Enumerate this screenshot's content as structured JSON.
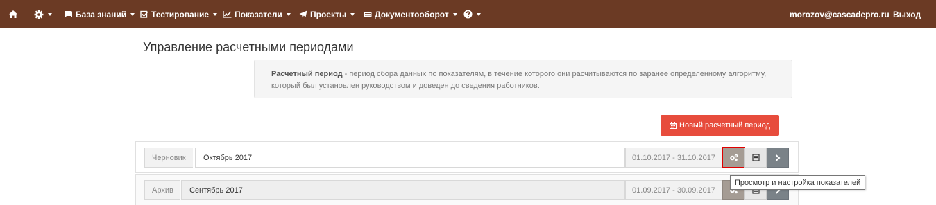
{
  "navbar": {
    "home_icon": "home-icon",
    "settings_icon": "gear-icon",
    "items": [
      {
        "label": "База знаний",
        "icon": "book-icon"
      },
      {
        "label": "Тестирование",
        "icon": "checkbox-icon"
      },
      {
        "label": "Показатели",
        "icon": "chart-line-icon"
      },
      {
        "label": "Проекты",
        "icon": "paper-plane-icon"
      },
      {
        "label": "Документооборот",
        "icon": "document-icon"
      }
    ],
    "help_icon": "question-circle-icon",
    "user_email": "morozov@cascadepro.ru",
    "logout_label": "Выход",
    "color": "#6b3a24"
  },
  "page": {
    "title": "Управление расчетными периодами",
    "info_term": "Расчетный период",
    "info_text": " - период сбора данных по показателям, в течение которого они расчитываются по заранее определенному алгоритму, который был установлен руководством и доведен до сведения работников.",
    "new_button_label": "Новый расчетный период",
    "new_button_color": "#e74c3c"
  },
  "periods": [
    {
      "status": "Черновик",
      "name": "Октябрь 2017",
      "dates": "01.10.2017 - 31.10.2017"
    },
    {
      "status": "Архив",
      "name": "Сентябрь 2017",
      "dates": "01.09.2017 - 30.09.2017"
    }
  ],
  "tooltip": "Просмотр и настройка показателей"
}
